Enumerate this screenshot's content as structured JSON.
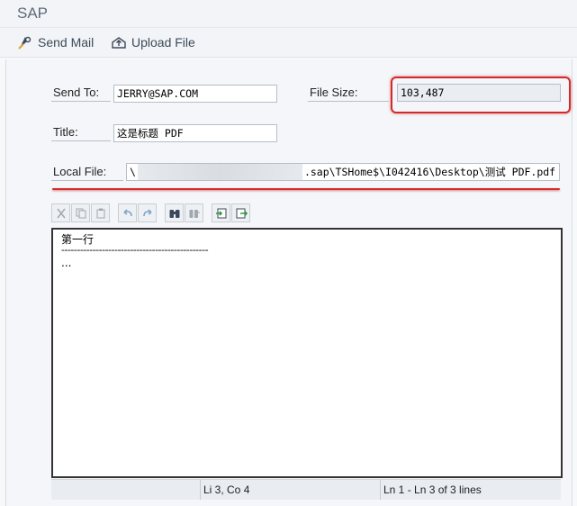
{
  "app": {
    "title": "SAP"
  },
  "toolbar": {
    "send_mail": "Send Mail",
    "upload_file": "Upload File"
  },
  "form": {
    "send_to_label": "Send To:",
    "send_to_value": "JERRY@SAP.COM",
    "file_size_label": "File Size:",
    "file_size_value": "103,487",
    "title_label": "Title:",
    "title_value": "这是标题 PDF",
    "local_file_label": "Local File:",
    "local_file_prefix": "\\",
    "local_file_suffix": ".sap\\TSHome$\\I042416\\Desktop\\测试 PDF.pdf"
  },
  "editor": {
    "lines": [
      "第一行",
      "-----------------------------------------------",
      "..."
    ]
  },
  "statusbar": {
    "cursor": "Li 3, Co 4",
    "lines": "Ln 1 - Ln 3 of 3 lines"
  },
  "colors": {
    "highlight": "#d42a2a",
    "accent": "#2a7ab8"
  }
}
